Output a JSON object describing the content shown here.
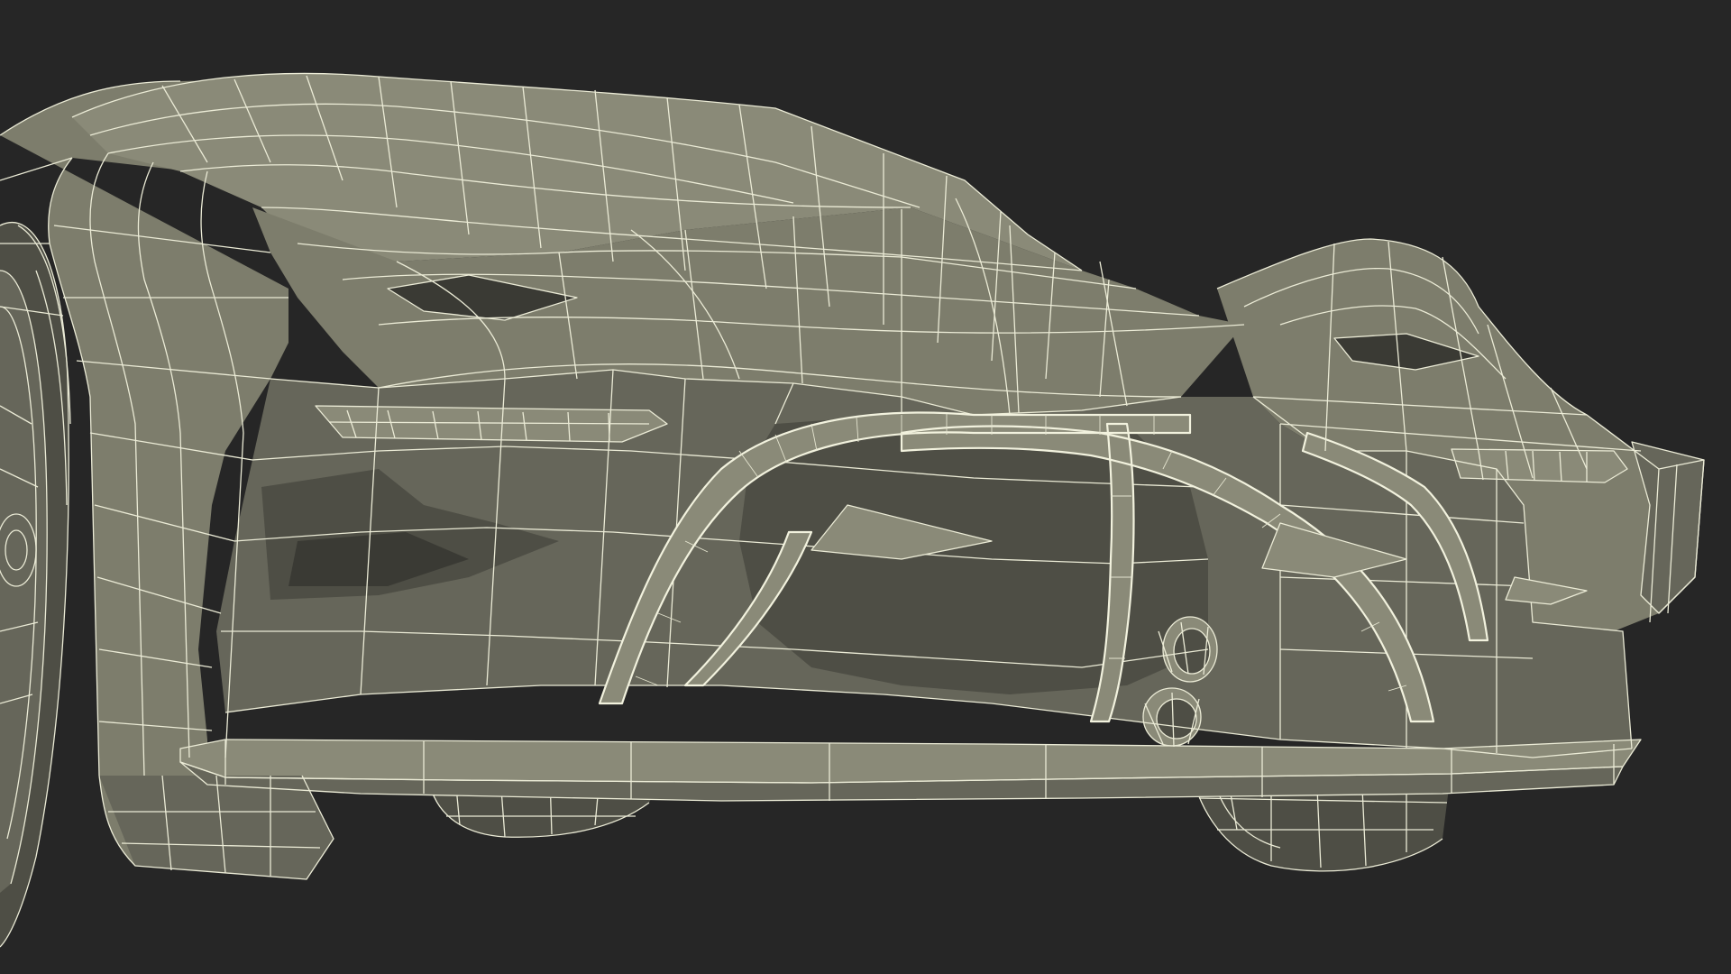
{
  "scene": {
    "subject": "car-wireframe-render",
    "background_color": "#262626",
    "surface_color": "#7d7d6c",
    "wire_color": "#ebebd6"
  }
}
